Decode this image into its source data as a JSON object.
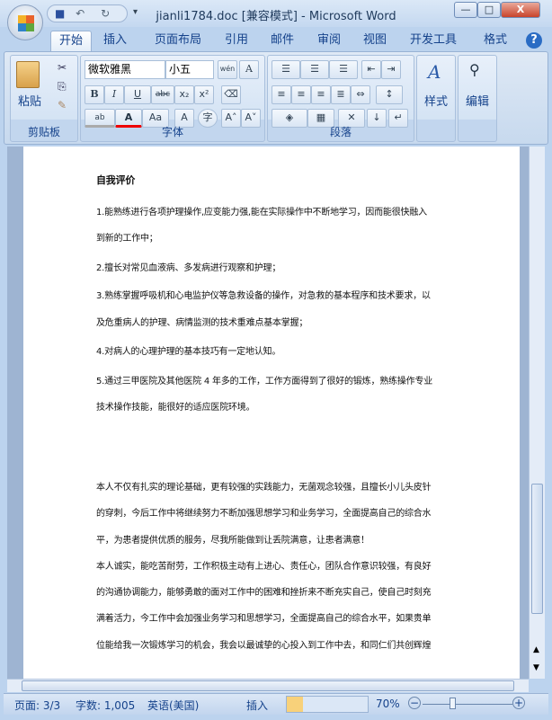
{
  "window": {
    "title": "jianli1784.doc [兼容模式] - Microsoft Word",
    "minimize": "—",
    "maximize": "□",
    "close": "X"
  },
  "qat": {
    "save": "■",
    "undo": "↶",
    "redo": "↻",
    "more": "▾"
  },
  "tabs": [
    "开始",
    "插入",
    "页面布局",
    "引用",
    "邮件",
    "审阅",
    "视图",
    "开发工具",
    "格式"
  ],
  "help": "?",
  "ribbon": {
    "clipboard": {
      "label": "剪贴板",
      "paste": "粘贴"
    },
    "font": {
      "label": "字体",
      "name": "微软雅黑",
      "size": "小五",
      "bold": "B",
      "italic": "I",
      "underline": "U",
      "strike": "abc",
      "sub": "x₂",
      "sup": "x²",
      "highlight": "ab",
      "color": "A",
      "case": "Aa",
      "charshade": "A",
      "enclose": "字",
      "grow": "A˄",
      "shrink": "A˅",
      "phonetic": "wén",
      "border": "A"
    },
    "paragraph": {
      "label": "段落"
    },
    "styles": {
      "label": "样式"
    },
    "editing": {
      "label": "编辑"
    }
  },
  "document": {
    "heading": "自我评价",
    "lines": [
      "1.能熟练进行各项护理操作,应变能力强,能在实际操作中不断地学习，因而能很快融入",
      "到新的工作中；",
      "2.擅长对常见血液病、多发病进行观察和护理；",
      "3.熟练掌握呼吸机和心电监护仪等急救设备的操作，对急救的基本程序和技术要求，以",
      "及危重病人的护理、病情监测的技术重难点基本掌握；",
      "4.对病人的心理护理的基本技巧有一定地认知。",
      "5.通过三甲医院及其他医院 4 年多的工作，工作方面得到了很好的锻炼，熟练操作专业",
      "技术操作技能，能很好的适应医院环境。",
      "本人不仅有扎实的理论基础，更有较强的实践能力，无菌观念较强，且擅长小儿头皮针",
      "的穿刺，今后工作中将继续努力不断加强思想学习和业务学习，全面提高自己的综合水",
      "平，为患者提供优质的服务，尽我所能做到让丢院满意，让患者满意！",
      "本人诚实，能吃苦耐劳，工作积极主动有上进心、责任心，团队合作意识较强，有良好",
      "的沟通协调能力，能够勇敢的面对工作中的困难和挫折来不断充实自己，使自己时刻充",
      "满着活力，今工作中会加强业务学习和思想学习，全面提高自己的综合水平，如果贵单",
      "位能给我一次锻炼学习的机会，我会以最诚挚的心投入到工作中去，和同仁们共创辉煌"
    ]
  },
  "status": {
    "page": "页面: 3/3",
    "words": "字数: 1,005",
    "language": "英语(美国)",
    "mode": "插入",
    "zoom": "70%",
    "zoom_percent": 70
  }
}
